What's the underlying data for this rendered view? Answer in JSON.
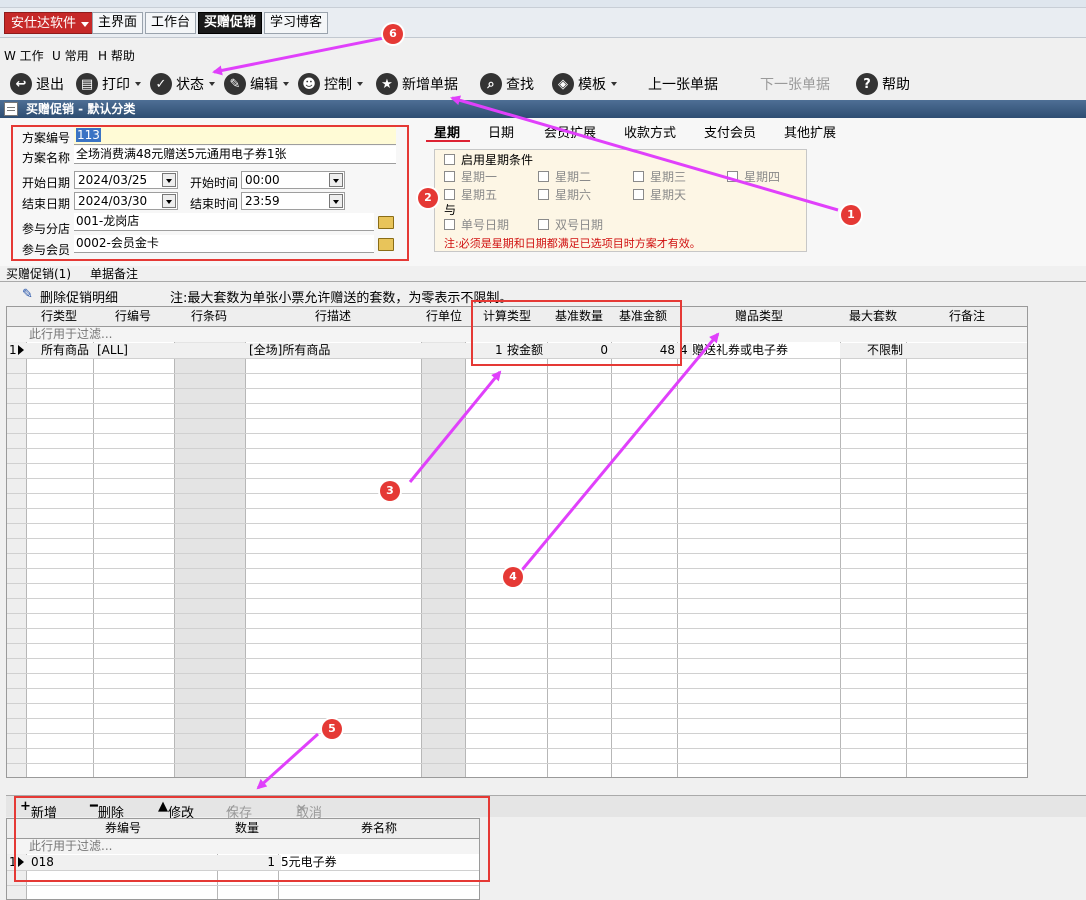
{
  "brand": {
    "label": "安仕达软件"
  },
  "tabs": [
    {
      "label": "主界面"
    },
    {
      "label": "工作台"
    },
    {
      "label": "买赠促销"
    },
    {
      "label": "学习博客"
    }
  ],
  "menu": {
    "work": "W 工作",
    "common": "U 常用",
    "help": "H 帮助"
  },
  "toolbar": {
    "exit": "退出",
    "print": "打印",
    "status": "状态",
    "edit": "编辑",
    "control": "控制",
    "new_doc": "新增单据",
    "find": "查找",
    "template": "模板",
    "prev": "上一张单据",
    "next": "下一张单据",
    "help": "帮助"
  },
  "section": {
    "title": "买赠促销 - 默认分类"
  },
  "form": {
    "plan_no_label": "方案编号",
    "plan_no": "113",
    "plan_name_label": "方案名称",
    "plan_name": "全场消费满48元赠送5元通用电子券1张",
    "start_date_label": "开始日期",
    "start_date": "2024/03/25",
    "start_time_label": "开始时间",
    "start_time": "00:00",
    "end_date_label": "结束日期",
    "end_date": "2024/03/30",
    "end_time_label": "结束时间",
    "end_time": "23:59",
    "branch_label": "参与分店",
    "branch": "001-龙岗店",
    "member_label": "参与会员",
    "member": "0002-会员金卡"
  },
  "subtabs": [
    "星期",
    "日期",
    "会员扩展",
    "收款方式",
    "支付会员",
    "其他扩展"
  ],
  "weekdays": {
    "enable": "启用星期条件",
    "mon": "星期一",
    "tue": "星期二",
    "wed": "星期三",
    "thu": "星期四",
    "fri": "星期五",
    "sat": "星期六",
    "sun": "星期天",
    "and": "与",
    "odd": "单号日期",
    "even": "双号日期",
    "note": "注:必须是星期和日期都满足已选项目时方案才有效。"
  },
  "detail_tabs": [
    "买赠促销(1)",
    "单据备注"
  ],
  "grid_tools": {
    "delete": "删除促销明细",
    "note": "注:最大套数为单张小票允许赠送的套数，为零表示不限制。"
  },
  "grid": {
    "headers": [
      "行类型",
      "行编号",
      "行条码",
      "行描述",
      "行单位",
      "计算类型",
      "基准数量",
      "基准金额",
      "赠品类型",
      "最大套数",
      "行备注"
    ],
    "filter_hint": "此行用于过滤...",
    "row": {
      "num": "1",
      "type": "所有商品",
      "code": "[ALL]",
      "desc": "[全场]所有商品",
      "calc_no": "1",
      "calc": "按金额",
      "qty": "0",
      "amount": "48",
      "gift_no": "4",
      "gift": "赠送礼券或电子券",
      "max": "不限制"
    }
  },
  "subbar": {
    "add": "新增",
    "delete": "删除",
    "modify": "修改",
    "save": "保存",
    "cancel": "取消"
  },
  "subgrid": {
    "headers": [
      "券编号",
      "数量",
      "券名称"
    ],
    "filter_hint": "此行用于过滤...",
    "row": {
      "num": "1",
      "code": "018",
      "qty": "1",
      "name": "5元电子券"
    }
  },
  "markers": [
    "1",
    "2",
    "3",
    "4",
    "5",
    "6"
  ],
  "colors": {
    "annotation": "#e53935",
    "arrow": "#e040fb",
    "accent": "#2e4d72"
  }
}
